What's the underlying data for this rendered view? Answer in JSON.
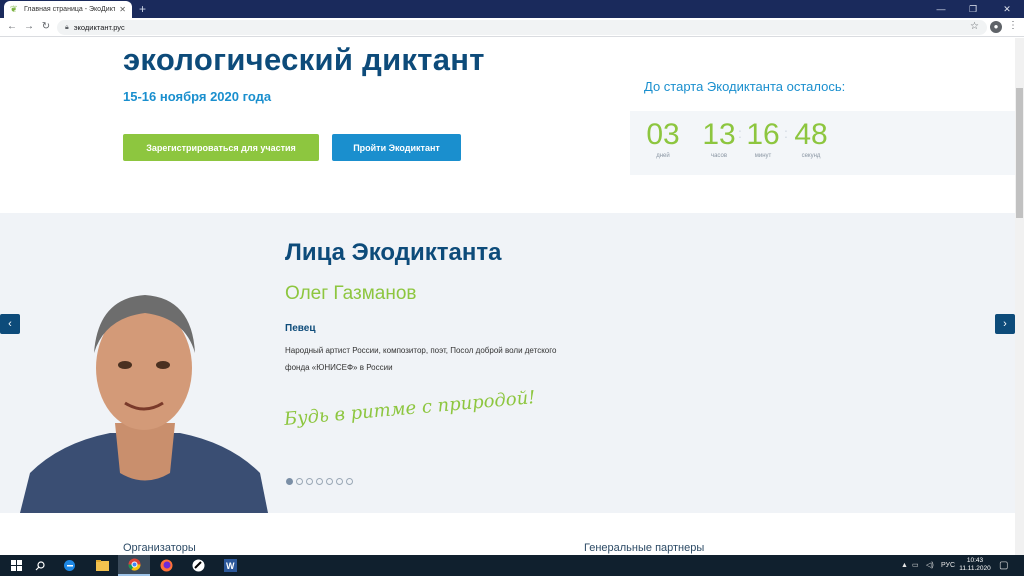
{
  "browser": {
    "tab_title": "Главная страница - ЭкоДиктант",
    "new_tab": "+",
    "url": "экодиктант.рус",
    "window_controls": [
      "—",
      "❐",
      "✕"
    ]
  },
  "hero": {
    "title": "экологический диктант",
    "date": "15-16 ноября 2020 года",
    "register_button": "Зарегистрироваться для участия",
    "take_button": "Пройти Экодиктант"
  },
  "countdown": {
    "label": "До старта Экодиктанта осталось:",
    "units": [
      {
        "value": "03",
        "label": "дней"
      },
      {
        "value": "13",
        "label": "часов"
      },
      {
        "value": "16",
        "label": "минут"
      },
      {
        "value": "48",
        "label": "секунд"
      }
    ]
  },
  "faces": {
    "title": "Лица Экодиктанта",
    "name": "Олег Газманов",
    "role": "Певец",
    "description": "Народный артист России, композитор, поэт, Посол доброй воли детского фонда «ЮНИСЕФ» в России",
    "slogan": "Будь в ритме с природой!",
    "slide_count": 7,
    "active_slide": 1
  },
  "footer": {
    "organizers": "Организаторы",
    "partners": "Генеральные партнеры"
  },
  "taskbar": {
    "lang": "РУС",
    "time": "10:43",
    "date": "11.11.2020"
  },
  "colors": {
    "navy": "#0d4b7a",
    "blue": "#1a8fce",
    "green": "#8dc63f"
  }
}
